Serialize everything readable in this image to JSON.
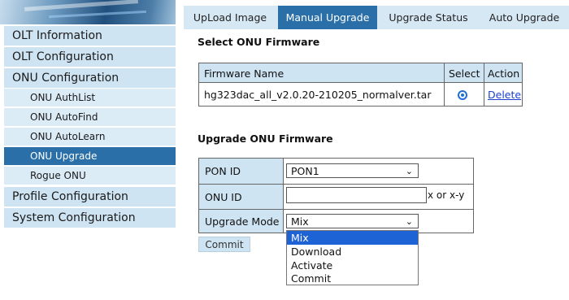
{
  "sidebar": {
    "items": [
      {
        "label": "OLT Information"
      },
      {
        "label": "OLT Configuration"
      },
      {
        "label": "ONU Configuration"
      },
      {
        "label": "ONU AuthList"
      },
      {
        "label": "ONU AutoFind"
      },
      {
        "label": "ONU AutoLearn"
      },
      {
        "label": "ONU Upgrade"
      },
      {
        "label": "Rogue ONU"
      },
      {
        "label": "Profile Configuration"
      },
      {
        "label": "System Configuration"
      }
    ]
  },
  "tabs": [
    {
      "label": "UpLoad Image"
    },
    {
      "label": "Manual Upgrade"
    },
    {
      "label": "Upgrade Status"
    },
    {
      "label": "Auto Upgrade"
    }
  ],
  "firmware": {
    "title": "Select ONU Firmware",
    "headers": {
      "name": "Firmware Name",
      "select": "Select",
      "action": "Action"
    },
    "rows": [
      {
        "name": "hg323dac_all_v2.0.20-210205_normalver.tar",
        "action": "Delete"
      }
    ]
  },
  "upgrade": {
    "title": "Upgrade ONU Firmware",
    "pon_label": "PON ID",
    "pon_value": "PON1",
    "onu_label": "ONU ID",
    "onu_value": "",
    "onu_hint": "x or x-y",
    "mode_label": "Upgrade Mode",
    "mode_value": "Mix",
    "mode_options": [
      "Mix",
      "Download",
      "Activate",
      "Commit"
    ],
    "commit_label": "Commit"
  },
  "colors": {
    "accent": "#2a6fa8",
    "menu_bg": "#cfe4f3",
    "selected_option": "#1e63d6"
  }
}
